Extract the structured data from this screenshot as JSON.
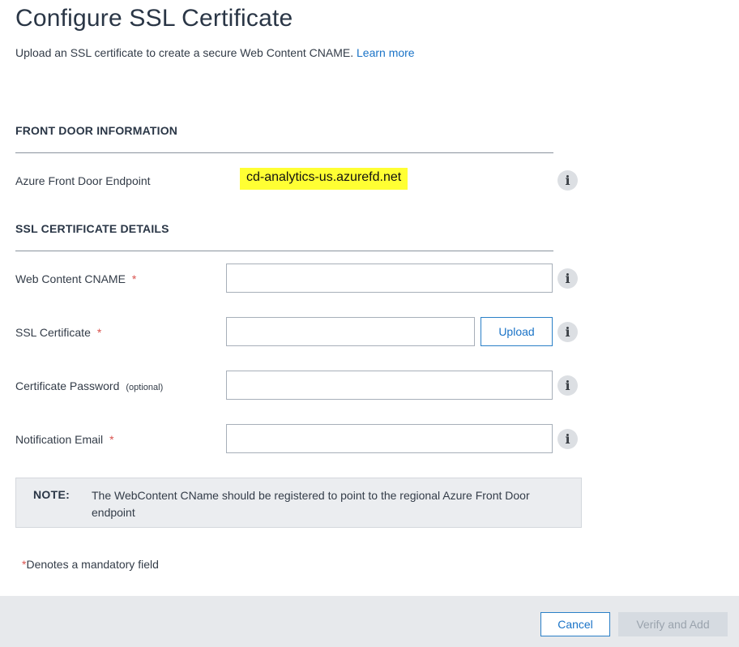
{
  "header": {
    "title": "Configure SSL Certificate",
    "subtitle": "Upload an SSL certificate to create a secure Web Content CNAME.",
    "learn_more": "Learn more"
  },
  "front_door": {
    "heading": "FRONT DOOR INFORMATION",
    "endpoint_label": "Azure Front Door Endpoint",
    "endpoint_value": "cd-analytics-us.azurefd.net"
  },
  "ssl": {
    "heading": "SSL CERTIFICATE DETAILS",
    "cname_label": "Web Content CNAME",
    "cname_value": "",
    "cert_label": "SSL Certificate",
    "cert_value": "",
    "upload_label": "Upload",
    "password_label": "Certificate Password",
    "password_optional": "(optional)",
    "password_value": "",
    "email_label": "Notification Email",
    "email_value": "",
    "required_marker": "*"
  },
  "note": {
    "label": "NOTE:",
    "text": "The WebContent CName should be registered to point to the regional Azure Front Door endpoint"
  },
  "mandatory": {
    "star": "*",
    "text": "Denotes a mandatory field"
  },
  "footer": {
    "cancel_label": "Cancel",
    "verify_label": "Verify and Add"
  },
  "icons": {
    "info": "info-icon",
    "info_glyph": "i"
  },
  "colors": {
    "accent": "#1a73c7",
    "required": "#d9534f",
    "highlight": "#ffff33",
    "footer_bg": "#e7e9ec",
    "disabled_button": "#d6dbe1"
  }
}
